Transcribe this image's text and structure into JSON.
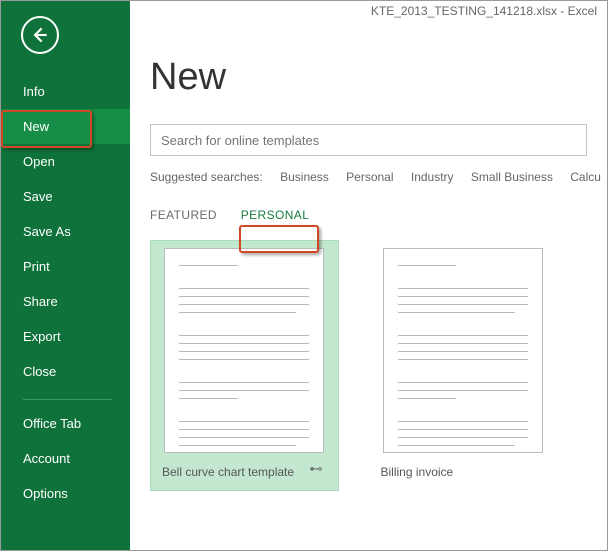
{
  "titlebar": "KTE_2013_TESTING_141218.xlsx - Excel",
  "sidebar": {
    "items": [
      "Info",
      "New",
      "Open",
      "Save",
      "Save As",
      "Print",
      "Share",
      "Export",
      "Close"
    ],
    "items2": [
      "Office Tab",
      "Account",
      "Options"
    ],
    "selected": "New"
  },
  "page": {
    "heading": "New",
    "search_placeholder": "Search for online templates",
    "suggested_label": "Suggested searches:",
    "suggestions": [
      "Business",
      "Personal",
      "Industry",
      "Small Business",
      "Calcu"
    ]
  },
  "tabs": {
    "featured": "FEATURED",
    "personal": "PERSONAL"
  },
  "templates": [
    {
      "caption": "Bell curve chart template",
      "selected": true
    },
    {
      "caption": "Billing invoice",
      "selected": false
    }
  ]
}
